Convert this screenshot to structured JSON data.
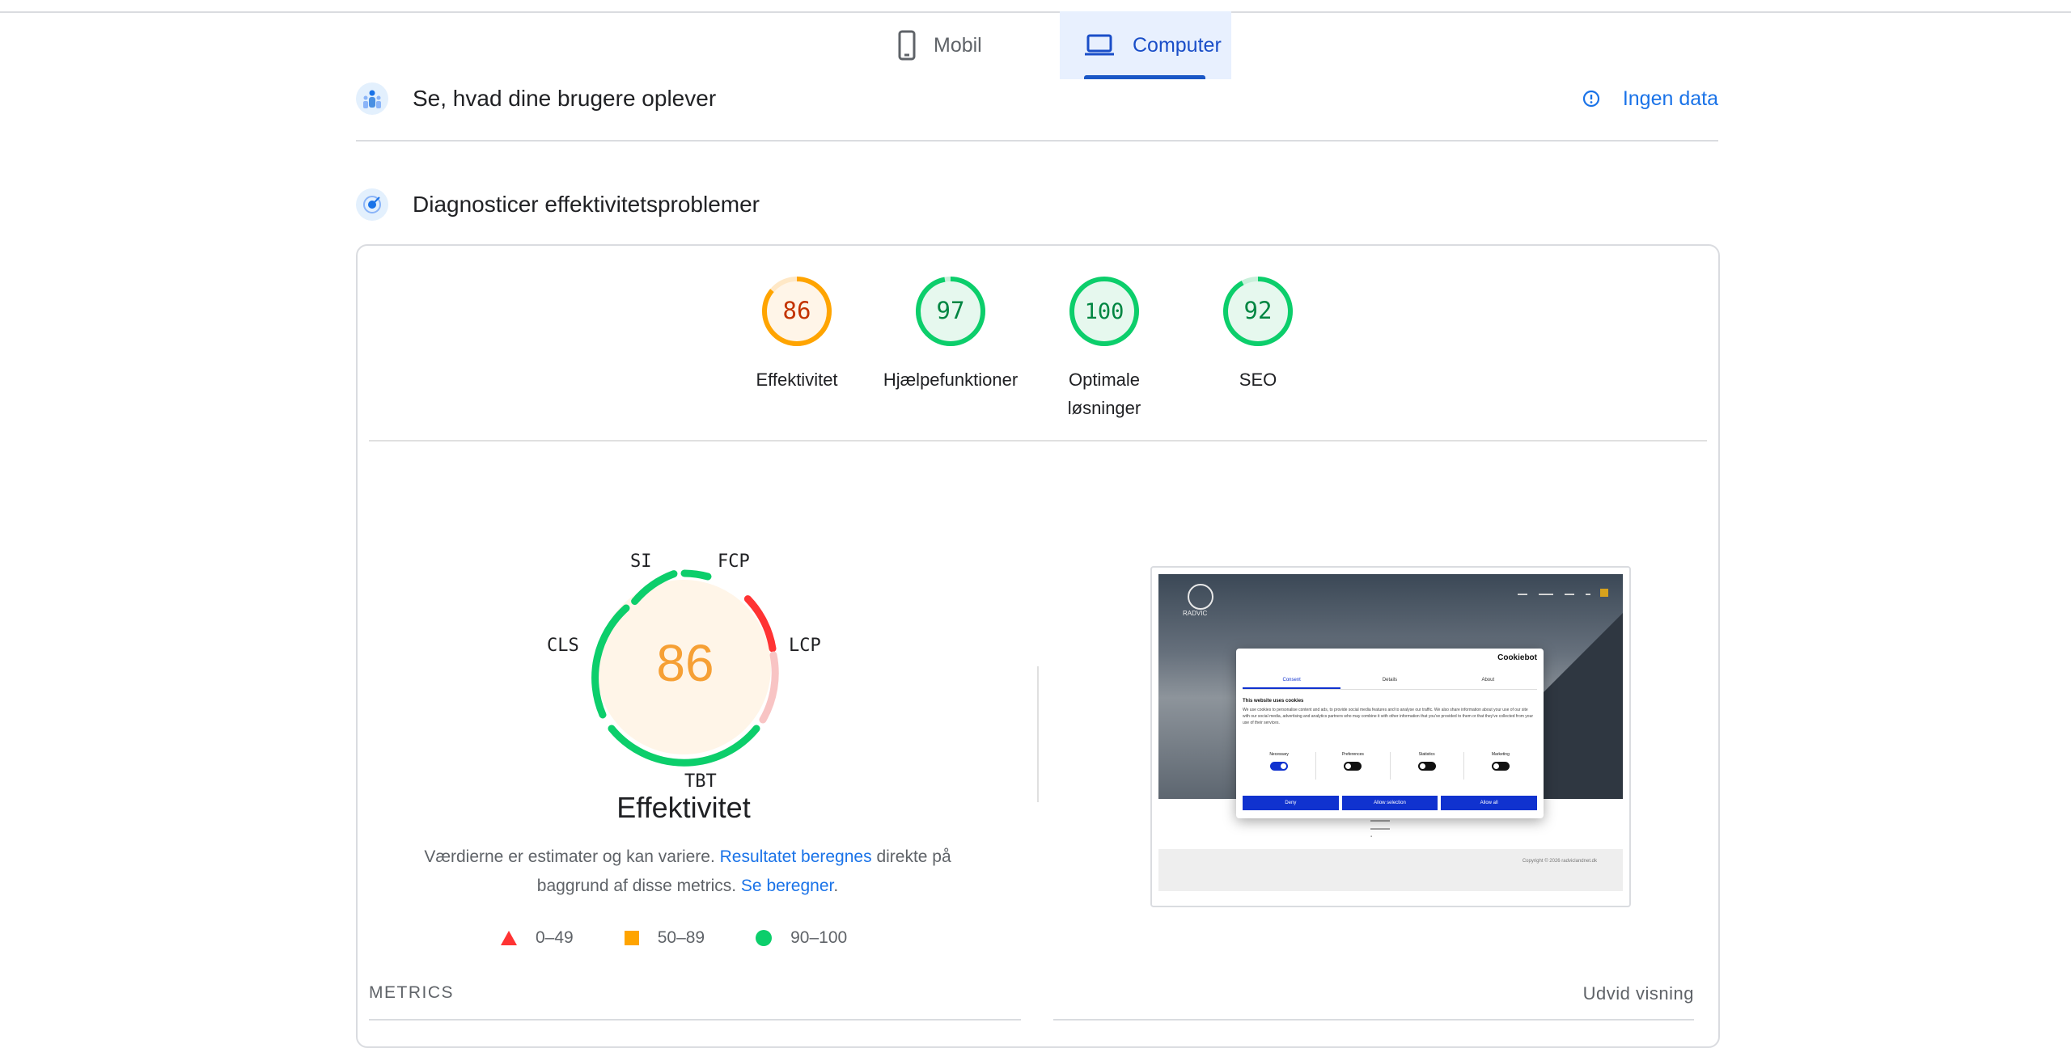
{
  "device_tabs": {
    "mobile": "Mobil",
    "desktop": "Computer",
    "active": "desktop"
  },
  "field_data": {
    "title": "Se, hvad dine brugere oplever",
    "status": "Ingen data"
  },
  "lab": {
    "title": "Diagnosticer effektivitetsproblemer",
    "scores": [
      {
        "value": "86",
        "label": "Effektivitet",
        "fraction": 0.86,
        "color": "#ffa400"
      },
      {
        "value": "97",
        "label": "Hjælpefunktioner",
        "fraction": 0.97,
        "color": "#0cce6b"
      },
      {
        "value": "100",
        "label": "Optimale løsninger",
        "fraction": 1.0,
        "color": "#0cce6b"
      },
      {
        "value": "92",
        "label": "SEO",
        "fraction": 0.92,
        "color": "#0cce6b"
      }
    ],
    "big_gauge": {
      "score": "86",
      "title": "Effektivitet",
      "metric_labels": {
        "si": "SI",
        "fcp": "FCP",
        "lcp": "LCP",
        "tbt": "TBT",
        "cls": "CLS"
      }
    },
    "note": {
      "text1": "Værdierne er estimater og kan variere. ",
      "link1": "Resultatet beregnes",
      "text2": " direkte på baggrund af disse metrics. ",
      "link2": "Se beregner",
      "text3": "."
    },
    "legend": [
      {
        "range": "0–49",
        "shape": "triangle",
        "color": "#ff3333"
      },
      {
        "range": "50–89",
        "shape": "square",
        "color": "#ffa400"
      },
      {
        "range": "90–100",
        "shape": "circle",
        "color": "#0cce6b"
      }
    ],
    "screenshot": {
      "logo_text": "RADVIC",
      "cookie_brand": "Cookiebot",
      "tabs": [
        "Consent",
        "Details",
        "About"
      ],
      "heading": "This website uses cookies",
      "body": "We use cookies to personalise content and ads, to provide social media features and to analyse our traffic. We also share information about your use of our site with our social media, advertising and analytics partners who may combine it with other information that you've provided to them or that they've collected from your use of their services.",
      "toggles": [
        "Necessary",
        "Preferences",
        "Statistics",
        "Marketing"
      ],
      "buttons": [
        "Deny",
        "Allow selection",
        "Allow all"
      ],
      "copyright": "Copyright © 2026 radviclandnet.dk"
    },
    "metrics_heading": "METRICS",
    "expand_label": "Udvid visning"
  }
}
